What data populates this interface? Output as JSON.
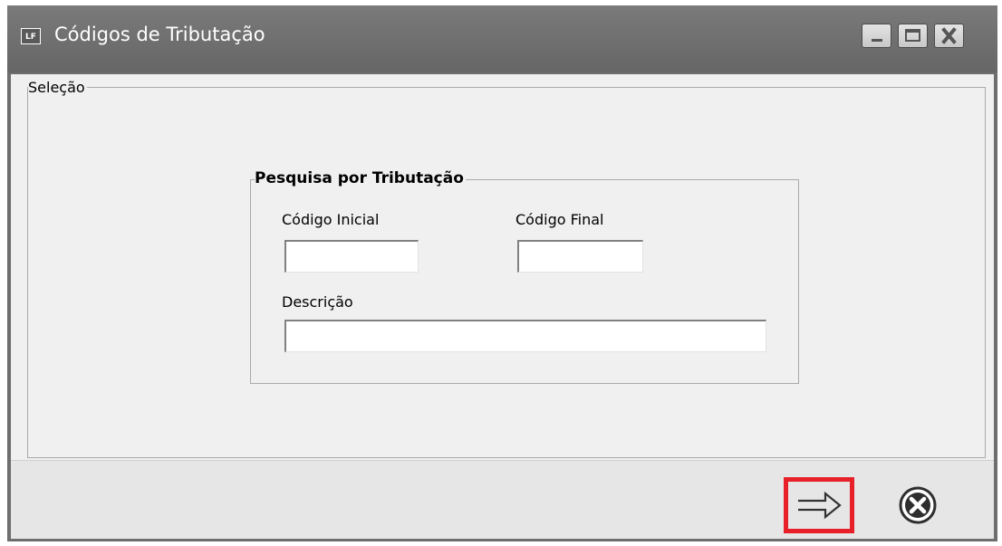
{
  "window": {
    "title": "Códigos de Tributação",
    "app_icon_text": "LF",
    "controls": [
      "minimize-icon",
      "maximize-icon",
      "close-icon"
    ]
  },
  "selection_group": {
    "legend": "Seleção"
  },
  "search_group": {
    "legend": "Pesquisa por Tributação",
    "codigo_inicial": {
      "label": "Código Inicial",
      "value": ""
    },
    "codigo_final": {
      "label": "Código Final",
      "value": ""
    },
    "descricao": {
      "label": "Descrição",
      "value": ""
    }
  },
  "footer": {
    "confirm_icon": "arrow-right-icon",
    "cancel_icon": "cancel-circle-icon",
    "highlight_color": "#e8202a"
  },
  "colors": {
    "titlebar": "#6e6e6e",
    "client_bg": "#f0f0f0",
    "footer_bg": "#e6e6e6"
  }
}
